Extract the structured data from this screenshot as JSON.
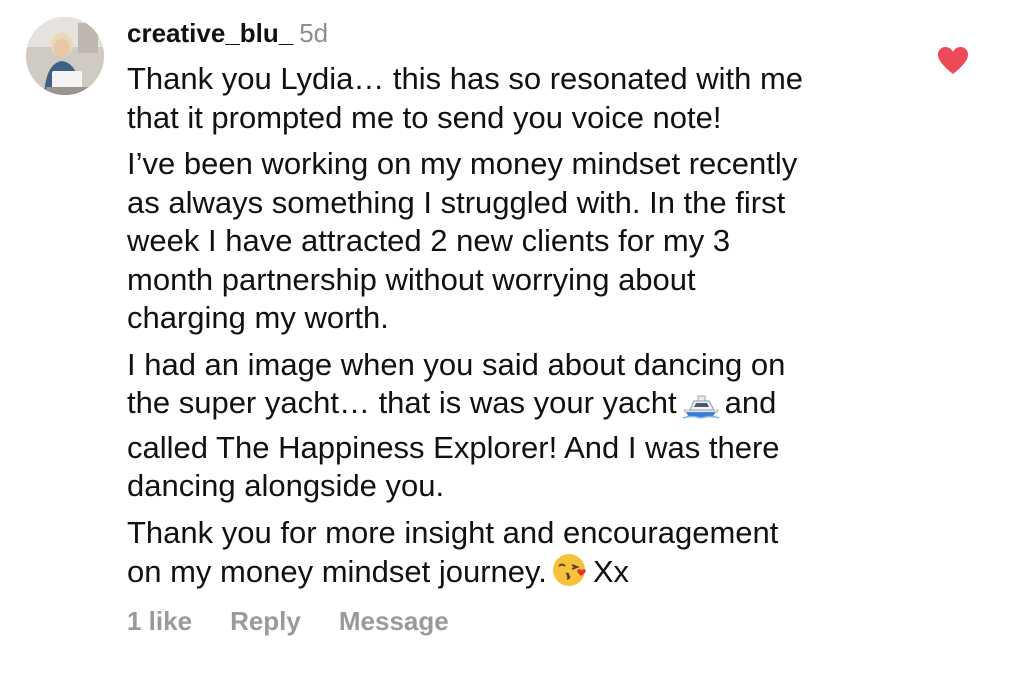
{
  "comment": {
    "username": "creative_blu_",
    "timestamp": "5d",
    "avatar_icon": "profile-photo",
    "liked": true,
    "heart_color": "#ed4956",
    "paragraphs": {
      "p1": "Thank you Lydia… this has so resonated with me\nthat it prompted me to send you voice note!",
      "p2": "I’ve been working on my money mindset recently\nas always something I struggled with. In the first\nweek I have attracted 2 new clients for my 3\nmonth partnership without worrying about\ncharging my worth.",
      "p3_before_emoji": "I had an image when you said about dancing on\nthe super yacht… that is was your yacht",
      "p3_emoji": "motor-boat-emoji",
      "p3_after_emoji": "and\ncalled The Happiness Explorer! And I was there\ndancing alongside you.",
      "p4_before_emoji": "Thank you for more insight and encouragement\non my money mindset journey.",
      "p4_emoji": "face-blowing-kiss-emoji",
      "p4_after_emoji": "Xx"
    },
    "actions": {
      "likes": "1 like",
      "reply": "Reply",
      "message": "Message"
    }
  }
}
